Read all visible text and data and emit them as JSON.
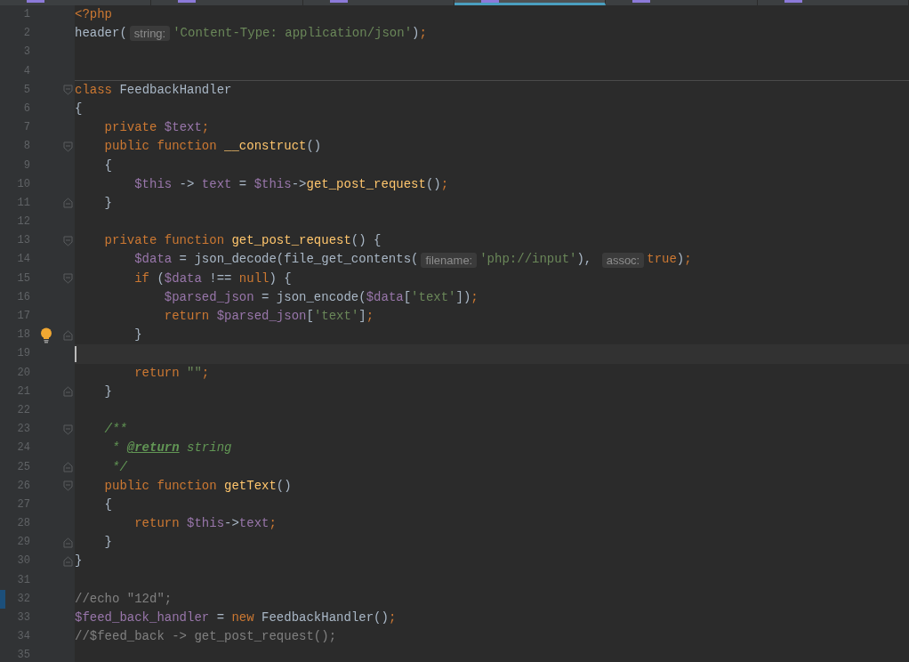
{
  "tabs": [
    {
      "selected": false
    },
    {
      "selected": false
    },
    {
      "selected": false
    },
    {
      "selected": true
    },
    {
      "selected": false
    },
    {
      "selected": false
    }
  ],
  "editor": {
    "lines": [
      {
        "number": "1",
        "tokens": [
          {
            "kind": "kw",
            "text": "<?php"
          }
        ]
      },
      {
        "number": "2",
        "tokens": [
          {
            "kind": "plain",
            "text": "header("
          },
          {
            "kind": "hint",
            "text": "string:"
          },
          {
            "kind": "str",
            "text": "'Content-Type: application/json'"
          },
          {
            "kind": "plain",
            "text": ")"
          },
          {
            "kind": "kw",
            "text": ";"
          }
        ]
      },
      {
        "number": "3"
      },
      {
        "number": "4",
        "separator": true
      },
      {
        "number": "5",
        "fold_start": true,
        "tokens": [
          {
            "kind": "kw",
            "text": "class "
          },
          {
            "kind": "plain",
            "text": "FeedbackHandler"
          }
        ]
      },
      {
        "number": "6",
        "tokens": [
          {
            "kind": "plain",
            "text": "{"
          }
        ]
      },
      {
        "number": "7",
        "tokens": [
          {
            "kind": "kw",
            "text": "    private "
          },
          {
            "kind": "var",
            "text": "$text"
          },
          {
            "kind": "kw",
            "text": ";"
          }
        ]
      },
      {
        "number": "8",
        "fold_start": true,
        "tokens": [
          {
            "kind": "kw",
            "text": "    public function "
          },
          {
            "kind": "func",
            "text": "__construct"
          },
          {
            "kind": "plain",
            "text": "()"
          }
        ]
      },
      {
        "number": "9",
        "tokens": [
          {
            "kind": "plain",
            "text": "    {"
          }
        ]
      },
      {
        "number": "10",
        "tokens": [
          {
            "kind": "var",
            "text": "        $this"
          },
          {
            "kind": "plain",
            "text": " -> "
          },
          {
            "kind": "var",
            "text": "text"
          },
          {
            "kind": "plain",
            "text": " = "
          },
          {
            "kind": "var",
            "text": "$this"
          },
          {
            "kind": "plain",
            "text": "->"
          },
          {
            "kind": "func",
            "text": "get_post_request"
          },
          {
            "kind": "plain",
            "text": "()"
          },
          {
            "kind": "kw",
            "text": ";"
          }
        ]
      },
      {
        "number": "11",
        "fold_end": true,
        "tokens": [
          {
            "kind": "plain",
            "text": "    }"
          }
        ]
      },
      {
        "number": "12"
      },
      {
        "number": "13",
        "fold_start": true,
        "tokens": [
          {
            "kind": "kw",
            "text": "    private function "
          },
          {
            "kind": "func",
            "text": "get_post_request"
          },
          {
            "kind": "plain",
            "text": "() {"
          }
        ]
      },
      {
        "number": "14",
        "tokens": [
          {
            "kind": "var",
            "text": "        $data"
          },
          {
            "kind": "plain",
            "text": " = json_decode(file_get_contents("
          },
          {
            "kind": "hint",
            "text": "filename:"
          },
          {
            "kind": "str",
            "text": "'php://input'"
          },
          {
            "kind": "plain",
            "text": "), "
          },
          {
            "kind": "hint",
            "text": "assoc:"
          },
          {
            "kind": "kw",
            "text": "true"
          },
          {
            "kind": "plain",
            "text": ")"
          },
          {
            "kind": "kw",
            "text": ";"
          }
        ]
      },
      {
        "number": "15",
        "fold_start": true,
        "tokens": [
          {
            "kind": "kw",
            "text": "        if "
          },
          {
            "kind": "plain",
            "text": "("
          },
          {
            "kind": "var",
            "text": "$data"
          },
          {
            "kind": "plain",
            "text": " !== "
          },
          {
            "kind": "kw",
            "text": "null"
          },
          {
            "kind": "plain",
            "text": ") {"
          }
        ]
      },
      {
        "number": "16",
        "tokens": [
          {
            "kind": "var",
            "text": "            $parsed_json"
          },
          {
            "kind": "plain",
            "text": " = json_encode("
          },
          {
            "kind": "var",
            "text": "$data"
          },
          {
            "kind": "plain",
            "text": "["
          },
          {
            "kind": "str",
            "text": "'text'"
          },
          {
            "kind": "plain",
            "text": "])"
          },
          {
            "kind": "kw",
            "text": ";"
          }
        ]
      },
      {
        "number": "17",
        "tokens": [
          {
            "kind": "kw",
            "text": "            return "
          },
          {
            "kind": "var",
            "text": "$parsed_json"
          },
          {
            "kind": "plain",
            "text": "["
          },
          {
            "kind": "str",
            "text": "'text'"
          },
          {
            "kind": "plain",
            "text": "]"
          },
          {
            "kind": "kw",
            "text": ";"
          }
        ]
      },
      {
        "number": "18",
        "fold_end": true,
        "bulb": true,
        "tokens": [
          {
            "kind": "plain",
            "text": "        }"
          }
        ]
      },
      {
        "number": "19",
        "current": true
      },
      {
        "number": "20",
        "tokens": [
          {
            "kind": "kw",
            "text": "        return "
          },
          {
            "kind": "str",
            "text": "\"\""
          },
          {
            "kind": "kw",
            "text": ";"
          }
        ]
      },
      {
        "number": "21",
        "fold_end": true,
        "tokens": [
          {
            "kind": "plain",
            "text": "    }"
          }
        ]
      },
      {
        "number": "22"
      },
      {
        "number": "23",
        "fold_start": true,
        "tokens": [
          {
            "kind": "doc",
            "text": "    /**"
          }
        ]
      },
      {
        "number": "24",
        "tokens": [
          {
            "kind": "doc",
            "text": "     * "
          },
          {
            "kind": "doctag",
            "text": "@return"
          },
          {
            "kind": "doctype",
            "text": " string"
          }
        ]
      },
      {
        "number": "25",
        "fold_end": true,
        "tokens": [
          {
            "kind": "doc",
            "text": "     */"
          }
        ]
      },
      {
        "number": "26",
        "fold_start": true,
        "tokens": [
          {
            "kind": "kw",
            "text": "    public function "
          },
          {
            "kind": "func",
            "text": "getText"
          },
          {
            "kind": "plain",
            "text": "()"
          }
        ]
      },
      {
        "number": "27",
        "tokens": [
          {
            "kind": "plain",
            "text": "    {"
          }
        ]
      },
      {
        "number": "28",
        "tokens": [
          {
            "kind": "kw",
            "text": "        return "
          },
          {
            "kind": "var",
            "text": "$this"
          },
          {
            "kind": "plain",
            "text": "->"
          },
          {
            "kind": "var",
            "text": "text"
          },
          {
            "kind": "kw",
            "text": ";"
          }
        ]
      },
      {
        "number": "29",
        "fold_end": true,
        "tokens": [
          {
            "kind": "plain",
            "text": "    }"
          }
        ]
      },
      {
        "number": "30",
        "fold_end": true,
        "tokens": [
          {
            "kind": "plain",
            "text": "}"
          }
        ]
      },
      {
        "number": "31"
      },
      {
        "number": "32",
        "modified": true,
        "tokens": [
          {
            "kind": "comment",
            "text": "//echo \"12d\";"
          }
        ]
      },
      {
        "number": "33",
        "tokens": [
          {
            "kind": "var",
            "text": "$feed_back_handler"
          },
          {
            "kind": "plain",
            "text": " = "
          },
          {
            "kind": "kw",
            "text": "new "
          },
          {
            "kind": "plain",
            "text": "FeedbackHandler()"
          },
          {
            "kind": "kw",
            "text": ";"
          }
        ]
      },
      {
        "number": "34",
        "tokens": [
          {
            "kind": "comment",
            "text": "//$feed_back -> get_post_request();"
          }
        ]
      },
      {
        "number": "35"
      }
    ]
  }
}
